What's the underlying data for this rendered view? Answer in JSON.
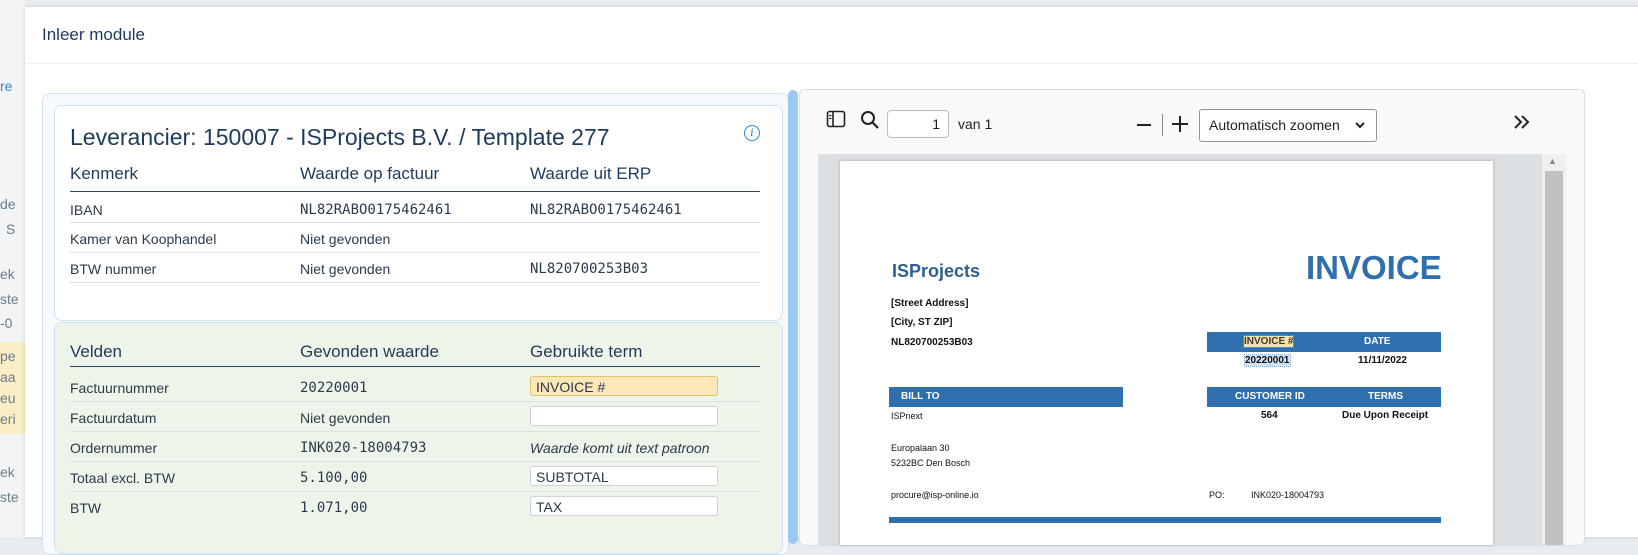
{
  "modal": {
    "title": "Inleer module"
  },
  "background": {
    "fragments": [
      "re",
      "de",
      "S",
      "ek",
      "ste",
      "-0",
      "pe",
      "aa",
      "eu",
      "eri",
      "ek",
      "ste"
    ]
  },
  "supplier": {
    "heading": "Leverancier: 150007 - ISProjects B.V. / Template 277",
    "columns": [
      "Kenmerk",
      "Waarde op factuur",
      "Waarde uit ERP"
    ],
    "rows": [
      {
        "label": "IBAN",
        "invoice": "NL82RABO0175462461",
        "erp": "NL82RABO0175462461"
      },
      {
        "label": "Kamer van Koophandel",
        "invoice": "Niet gevonden",
        "erp": ""
      },
      {
        "label": "BTW nummer",
        "invoice": "Niet gevonden",
        "erp": "NL820700253B03"
      }
    ]
  },
  "fields": {
    "columns": [
      "Velden",
      "Gevonden waarde",
      "Gebruikte term"
    ],
    "rows": [
      {
        "label": "Factuurnummer",
        "value": "20220001",
        "term": "INVOICE #"
      },
      {
        "label": "Factuurdatum",
        "value": "Niet gevonden",
        "term": ""
      },
      {
        "label": "Ordernummer",
        "value": "INK020-18004793",
        "term": "Waarde komt uit text patroon"
      },
      {
        "label": "Totaal excl. BTW",
        "value": "5.100,00",
        "term": "SUBTOTAL"
      },
      {
        "label": "BTW",
        "value": "1.071,00",
        "term": "TAX"
      }
    ]
  },
  "pdf_viewer": {
    "page_number": "1",
    "page_of": "van 1",
    "zoom": "Automatisch zoomen",
    "icons": [
      "sidebar-toggle-icon",
      "search-icon",
      "zoom-out-icon",
      "zoom-in-icon",
      "double-chevron-right-icon"
    ]
  },
  "invoice": {
    "company": "ISProjects",
    "title": "INVOICE",
    "address1": "[Street Address]",
    "address2": "[City, ST  ZIP]",
    "vat": "NL820700253B03",
    "invoice_no_label": "INVOICE #",
    "date_label": "DATE",
    "invoice_no": "20220001",
    "date": "11/11/2022",
    "bill_to_label": "BILL TO",
    "customer_id_label": "CUSTOMER ID",
    "terms_label": "TERMS",
    "bill_to_name": "ISPnext",
    "customer_id": "564",
    "terms": "Due Upon Receipt",
    "bill_addr1": "Europalaan 30",
    "bill_addr2": "5232BC Den Bosch",
    "email": "procure@isp-online.io",
    "po_label": "PO:",
    "po_value": "INK020-18004793"
  },
  "colors": {
    "accent": "#2f6fad",
    "highlight": "#fbe7b7",
    "scroll": "#9cc8f5"
  }
}
